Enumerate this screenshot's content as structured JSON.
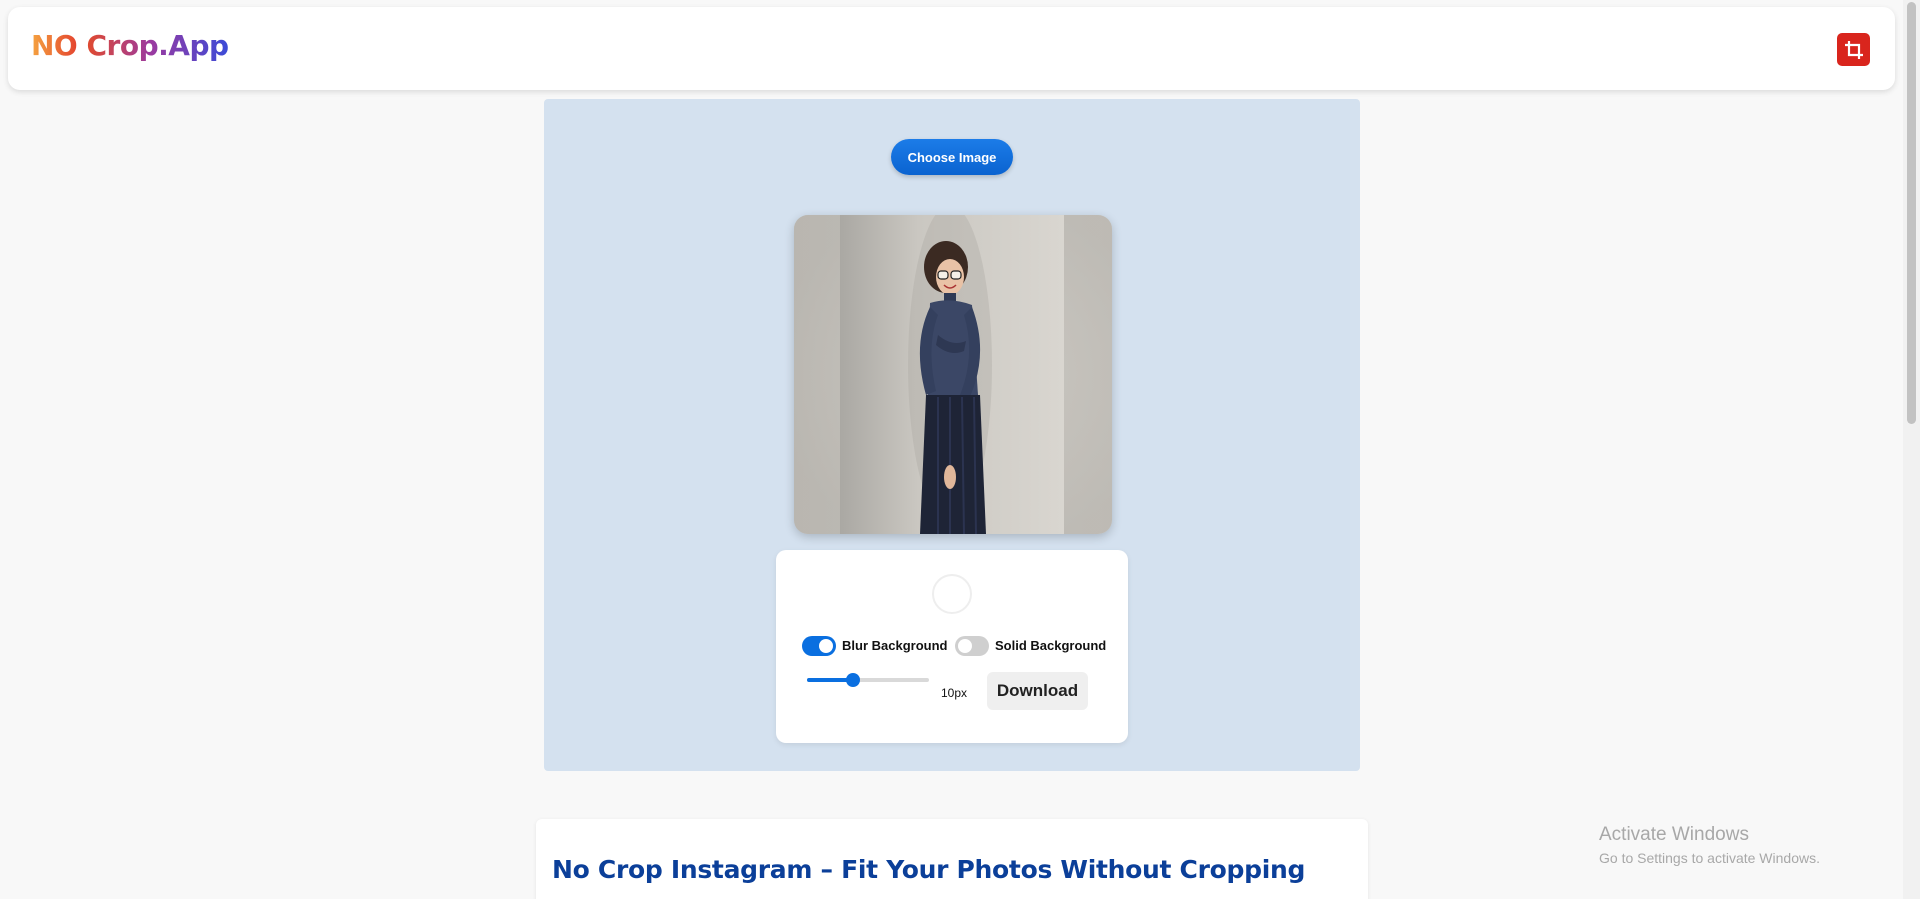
{
  "header": {
    "logo_prefix": "NO",
    "logo_rest": "Crop.App",
    "crop_icon": "crop-icon",
    "accent_color": "#d9251d"
  },
  "editor": {
    "choose_label": "Choose Image",
    "preview_image": "woman-in-lace-dress-photo",
    "background_color": "#d4e1ef"
  },
  "controls": {
    "blur_label": "Blur Background",
    "blur_enabled": true,
    "solid_label": "Solid Background",
    "solid_enabled": false,
    "blur_value_label": "10px",
    "blur_slider_fraction": 0.38,
    "download_label": "Download",
    "primary_color": "#0a6fe0"
  },
  "content": {
    "title": "No Crop Instagram – Fit Your Photos Without Cropping",
    "title_color": "#0b3f99"
  },
  "watermark": {
    "line1": "Activate Windows",
    "line2": "Go to Settings to activate Windows."
  }
}
